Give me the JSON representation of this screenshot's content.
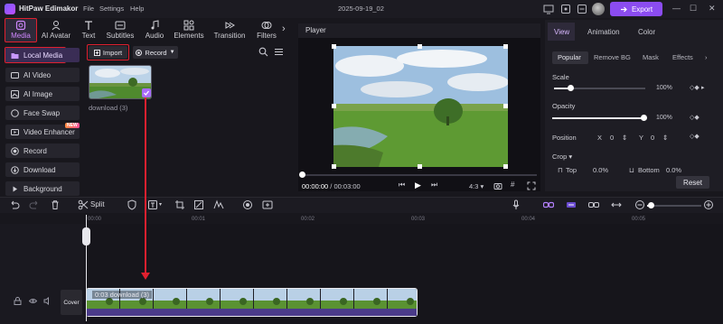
{
  "app": {
    "name": "HitPaw Edimakor",
    "doc_title": "2025-09-19_02"
  },
  "menu": [
    "File",
    "Settings",
    "Help"
  ],
  "export_label": "Export",
  "toolbar": [
    {
      "label": "Media",
      "icon": "media-icon"
    },
    {
      "label": "AI Avatar",
      "icon": "ai-avatar-icon"
    },
    {
      "label": "Text",
      "icon": "text-icon"
    },
    {
      "label": "Subtitles",
      "icon": "subtitles-icon"
    },
    {
      "label": "Audio",
      "icon": "audio-icon"
    },
    {
      "label": "Elements",
      "icon": "elements-icon"
    },
    {
      "label": "Transition",
      "icon": "transition-icon"
    },
    {
      "label": "Filters",
      "icon": "filters-icon"
    }
  ],
  "sidebar": [
    {
      "label": "Local Media",
      "icon": "folder-icon"
    },
    {
      "label": "AI Video",
      "icon": "ai-video-icon"
    },
    {
      "label": "AI Image",
      "icon": "ai-image-icon"
    },
    {
      "label": "Face Swap",
      "icon": "face-swap-icon"
    },
    {
      "label": "Video Enhancer",
      "icon": "video-enhancer-icon",
      "badge": "NEW"
    },
    {
      "label": "Record",
      "icon": "record-icon"
    },
    {
      "label": "Download",
      "icon": "download-icon"
    },
    {
      "label": "Background",
      "icon": "background-icon"
    }
  ],
  "media": {
    "import_label": "Import",
    "record_label": "Record",
    "item_name": "download (3)"
  },
  "player": {
    "title": "Player",
    "current_time": "00:00:00",
    "total_time": "00:03:00",
    "aspect": "4:3"
  },
  "props": {
    "tabs": [
      "View",
      "Animation",
      "Color"
    ],
    "subtabs": [
      "Popular",
      "Remove BG",
      "Mask",
      "Effects"
    ],
    "scale_label": "Scale",
    "scale_value": "100%",
    "scale_level": 1.0,
    "opacity_label": "Opacity",
    "opacity_value": "100%",
    "opacity_level": 1.0,
    "position_label": "Position",
    "x_label": "X",
    "x_value": "0",
    "y_label": "Y",
    "y_value": "0",
    "crop_label": "Crop",
    "top_label": "Top",
    "top_value": "0.0%",
    "bottom_label": "Bottom",
    "bottom_value": "0.0%",
    "reset_label": "Reset"
  },
  "timeline": {
    "split_label": "Split",
    "ticks": [
      "00:00",
      "00:01",
      "00:02",
      "00:03",
      "00:04",
      "00:05"
    ],
    "clip_label": "0:03 download (3)",
    "cover_label": "Cover"
  }
}
